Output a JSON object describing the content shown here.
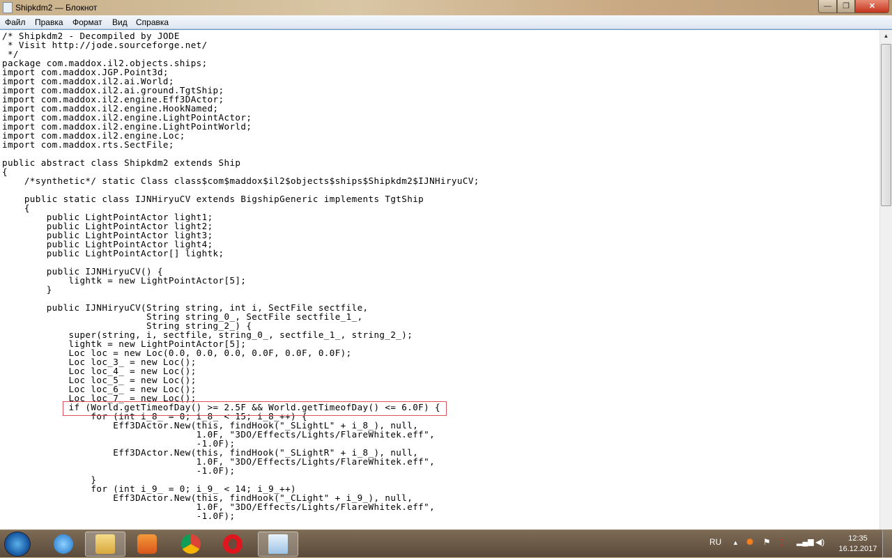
{
  "window": {
    "title": "Shipkdm2 — Блокнот",
    "minimize": "—",
    "maximize": "❐",
    "close": "✕"
  },
  "menu": [
    "Файл",
    "Правка",
    "Формат",
    "Вид",
    "Справка"
  ],
  "code": [
    "/* Shipkdm2 - Decompiled by JODE",
    " * Visit http://jode.sourceforge.net/",
    " */",
    "package com.maddox.il2.objects.ships;",
    "import com.maddox.JGP.Point3d;",
    "import com.maddox.il2.ai.World;",
    "import com.maddox.il2.ai.ground.TgtShip;",
    "import com.maddox.il2.engine.Eff3DActor;",
    "import com.maddox.il2.engine.HookNamed;",
    "import com.maddox.il2.engine.LightPointActor;",
    "import com.maddox.il2.engine.LightPointWorld;",
    "import com.maddox.il2.engine.Loc;",
    "import com.maddox.rts.SectFile;",
    "",
    "public abstract class Shipkdm2 extends Ship",
    "{",
    "    /*synthetic*/ static Class class$com$maddox$il2$objects$ships$Shipkdm2$IJNHiryuCV;",
    "",
    "    public static class IJNHiryuCV extends BigshipGeneric implements TgtShip",
    "    {",
    "        public LightPointActor light1;",
    "        public LightPointActor light2;",
    "        public LightPointActor light3;",
    "        public LightPointActor light4;",
    "        public LightPointActor[] lightk;",
    "",
    "        public IJNHiryuCV() {",
    "            lightk = new LightPointActor[5];",
    "        }",
    "",
    "        public IJNHiryuCV(String string, int i, SectFile sectfile,",
    "                          String string_0_, SectFile sectfile_1_,",
    "                          String string_2_) {",
    "            super(string, i, sectfile, string_0_, sectfile_1_, string_2_);",
    "            lightk = new LightPointActor[5];",
    "            Loc loc = new Loc(0.0, 0.0, 0.0, 0.0F, 0.0F, 0.0F);",
    "            Loc loc_3_ = new Loc();",
    "            Loc loc_4_ = new Loc();",
    "            Loc loc_5_ = new Loc();",
    "            Loc loc_6_ = new Loc();",
    "            Loc loc_7_ = new Loc();",
    "            if (World.getTimeofDay() >= 2.5F && World.getTimeofDay() <= 6.0F) {",
    "                for (int i_8_ = 0; i_8_ < 15; i_8_++) {",
    "                    Eff3DActor.New(this, findHook(\"_SLightL\" + i_8_), null,",
    "                                   1.0F, \"3DO/Effects/Lights/FlareWhitek.eff\",",
    "                                   -1.0F);",
    "                    Eff3DActor.New(this, findHook(\"_SLightR\" + i_8_), null,",
    "                                   1.0F, \"3DO/Effects/Lights/FlareWhitek.eff\",",
    "                                   -1.0F);",
    "                }",
    "                for (int i_9_ = 0; i_9_ < 14; i_9_++)",
    "                    Eff3DActor.New(this, findHook(\"_CLight\" + i_9_), null,",
    "                                   1.0F, \"3DO/Effects/Lights/FlareWhitek.eff\",",
    "                                   -1.0F);"
  ],
  "taskbar": {
    "lang": "RU",
    "time": "12:35",
    "date": "16.12.2017"
  }
}
